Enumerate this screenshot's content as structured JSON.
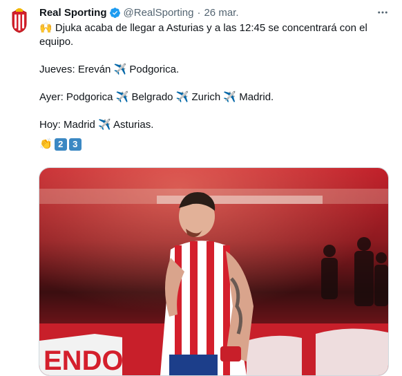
{
  "tweet": {
    "display_name": "Real Sporting",
    "handle": "@RealSporting",
    "separator": "·",
    "date": "26 mar.",
    "lines": [
      {
        "prefix": "🙌 ",
        "text": "Djuka acaba de llegar a Asturias y a las 12:45 se concentrará con el equipo."
      },
      {
        "text": "Jueves: Ereván ✈️ Podgorica."
      },
      {
        "text": "Ayer: Podgorica ✈️ Belgrado ✈️ Zurich ✈️ Madrid."
      },
      {
        "text": "Hoy: Madrid ✈️ Asturias."
      }
    ],
    "emoji_clap": "👏",
    "keycap_2": "2",
    "keycap_3": "3",
    "media_banner_text": "ENDO"
  },
  "colors": {
    "accent": "#1d9bf0",
    "text": "#0f1419",
    "secondary": "#536471",
    "sporting_red": "#d41f2c"
  }
}
